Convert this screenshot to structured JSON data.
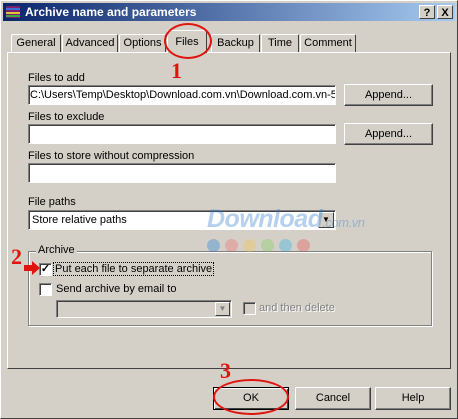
{
  "window": {
    "title": "Archive name and parameters",
    "help_label": "?",
    "close_label": "X"
  },
  "tabs": [
    "General",
    "Advanced",
    "Options",
    "Files",
    "Backup",
    "Time",
    "Comment"
  ],
  "files_tab": {
    "files_to_add_label": "Files to add",
    "files_to_add_value": "C:\\Users\\Temp\\Desktop\\Download.com.vn\\Download.com.vn-5",
    "files_to_exclude_label": "Files to exclude",
    "files_to_exclude_value": "",
    "files_no_compression_label": "Files to store without compression",
    "files_no_compression_value": "",
    "append_label": "Append...",
    "file_paths_label": "File paths",
    "file_paths_value": "Store relative paths"
  },
  "archive_group": {
    "title": "Archive",
    "separate_archive_label": "Put each file to separate archive",
    "separate_archive_checked": true,
    "send_email_label": "Send archive by email to",
    "send_email_checked": false,
    "email_value": "",
    "then_delete_label": "and then delete",
    "then_delete_checked": false
  },
  "buttons": {
    "ok": "OK",
    "cancel": "Cancel",
    "help": "Help"
  },
  "annotations": [
    "1",
    "2",
    "3"
  ],
  "watermark": {
    "main": "Download",
    "suffix": ".com.vn",
    "dot_colors": [
      "#1e7fd6",
      "#f26b6b",
      "#f3c545",
      "#7ccf5a",
      "#2bb3e8",
      "#ea4f4f"
    ]
  }
}
